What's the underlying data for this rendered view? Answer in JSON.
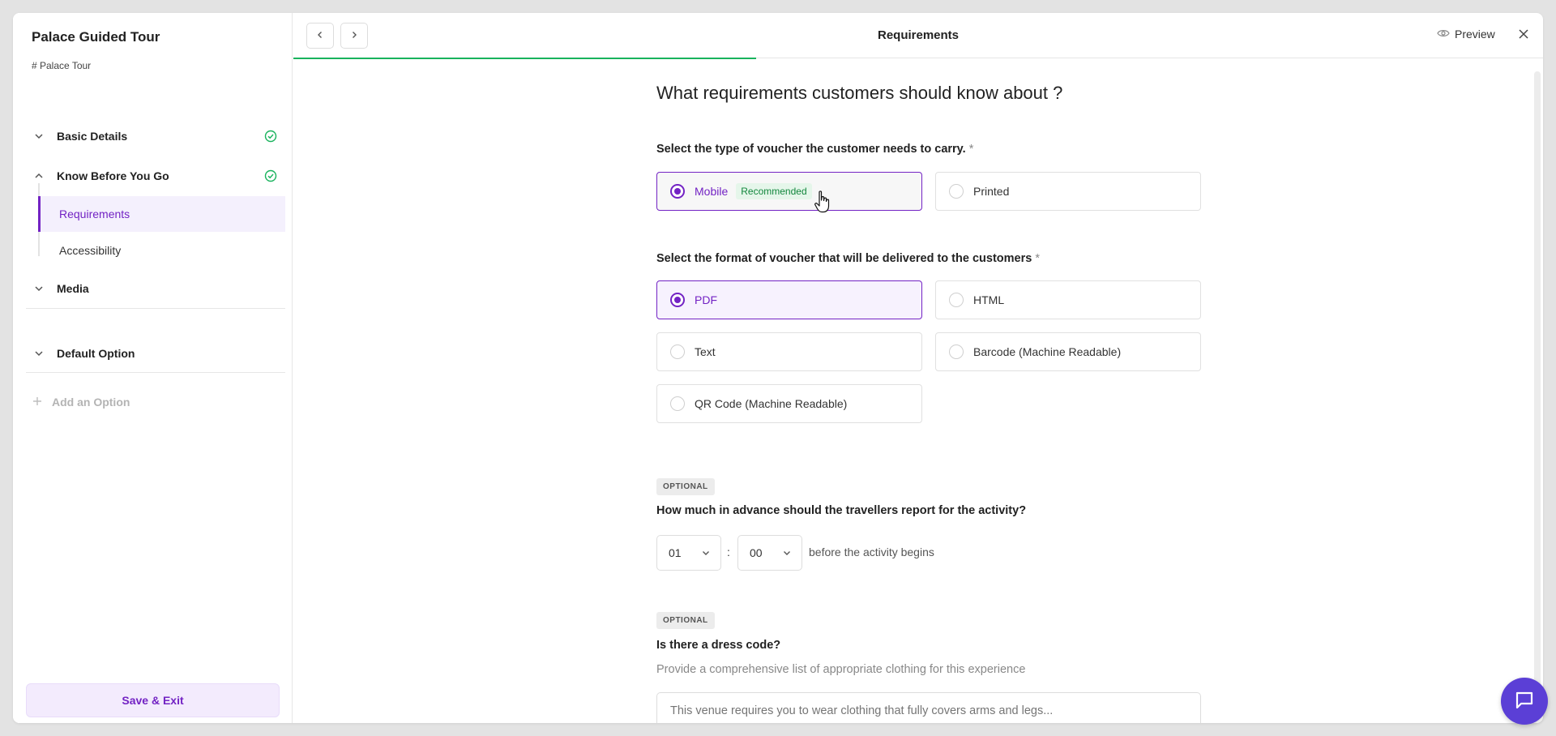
{
  "sidebar": {
    "title": "Palace Guided Tour",
    "subtitle": "# Palace Tour",
    "sections": {
      "basic_details": "Basic Details",
      "know_before": "Know Before You Go",
      "media": "Media",
      "default_option": "Default Option"
    },
    "subitems": {
      "requirements": "Requirements",
      "accessibility": "Accessibility"
    },
    "add_option": "Add an Option",
    "save_exit": "Save & Exit"
  },
  "topbar": {
    "title": "Requirements",
    "preview": "Preview",
    "progress": 0.37
  },
  "form": {
    "heading": "What requirements customers should know about ?",
    "voucher_type": {
      "label": "Select the type of voucher the customer needs to carry.",
      "options": [
        "Mobile",
        "Printed"
      ],
      "recommended": "Recommended",
      "selected": "Mobile"
    },
    "voucher_format": {
      "label": "Select the format of voucher that will be delivered to the customers",
      "options": [
        "PDF",
        "HTML",
        "Text",
        "Barcode (Machine Readable)",
        "QR Code (Machine Readable)"
      ],
      "selected": "PDF"
    },
    "required_mark": "*",
    "optional_tag": "OPTIONAL",
    "advance": {
      "label": "How much in advance should the travellers report for the activity?",
      "hours": "01",
      "separator": ":",
      "minutes": "00",
      "suffix": "before the activity begins"
    },
    "dress_code": {
      "label": "Is there a dress code?",
      "hint": "Provide a comprehensive list of appropriate clothing for this experience",
      "placeholder": "This venue requires you to wear clothing that fully covers arms and legs..."
    }
  },
  "colors": {
    "accent": "#7323c4",
    "progress": "#19b35d",
    "chat": "#5b3fd6"
  }
}
